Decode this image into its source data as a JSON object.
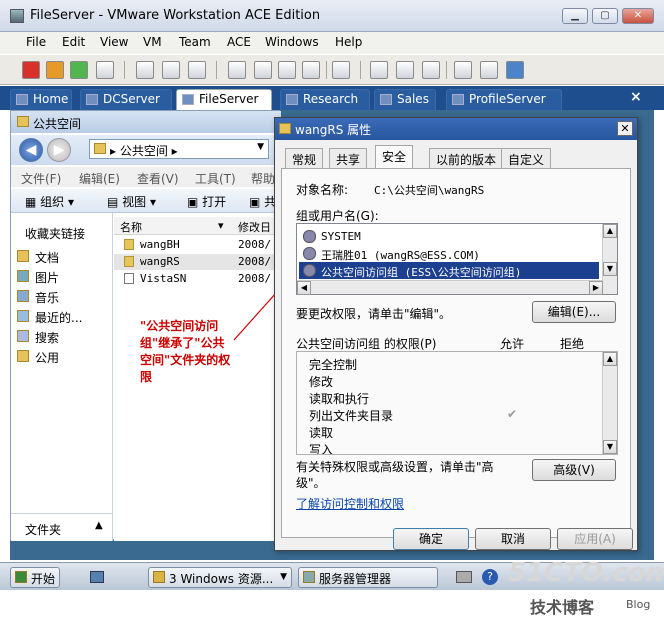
{
  "window": {
    "title": "FileServer - VMware Workstation ACE Edition"
  },
  "menubar": [
    "File",
    "Edit",
    "View",
    "VM",
    "Team",
    "ACE",
    "Windows",
    "Help"
  ],
  "tabs": [
    {
      "label": "Home",
      "active": false
    },
    {
      "label": "DCServer",
      "active": false
    },
    {
      "label": "FileServer",
      "active": true
    },
    {
      "label": "Research",
      "active": false
    },
    {
      "label": "Sales",
      "active": false
    },
    {
      "label": "ProfileServer",
      "active": false
    }
  ],
  "tab_close": "×",
  "explorer": {
    "title": "公共空间",
    "address": "▸ 公共空间 ▸",
    "menu": [
      "文件(F)",
      "编辑(E)",
      "查看(V)",
      "工具(T)",
      "帮助"
    ],
    "commands": {
      "organize": "组织",
      "views": "视图",
      "open": "打开",
      "share": "共"
    },
    "nav_header": "收藏夹链接",
    "nav_items": [
      "文档",
      "图片",
      "音乐",
      "最近的...",
      "搜索",
      "公用"
    ],
    "nav_footer": "文件夹",
    "columns": {
      "name": "名称",
      "date": "修改日"
    },
    "files": [
      {
        "name": "wangBH",
        "date": "2008/",
        "selected": false,
        "type": "folder"
      },
      {
        "name": "wangRS",
        "date": "2008/",
        "selected": true,
        "type": "folder"
      },
      {
        "name": "VistaSN",
        "date": "2008/",
        "selected": false,
        "type": "doc"
      }
    ]
  },
  "annotation": {
    "text": "\"公共空间访问组\"继承了\"公共空间\"文件夹的权限",
    "line_color": "#cc0000"
  },
  "dialog": {
    "title": "wangRS 属性",
    "close": "✕",
    "tabs": [
      {
        "label": "常规",
        "active": false
      },
      {
        "label": "共享",
        "active": false
      },
      {
        "label": "安全",
        "active": true
      },
      {
        "label": "以前的版本",
        "active": false
      },
      {
        "label": "自定义",
        "active": false
      }
    ],
    "object_label": "对象名称:",
    "object_value": "C:\\公共空间\\wangRS",
    "group_label": "组或用户名(G):",
    "groups": [
      {
        "name": "SYSTEM",
        "selected": false
      },
      {
        "name": "王瑞胜01 (wangRS@ESS.COM)",
        "selected": false
      },
      {
        "name": "公共空间访问组 (ESS\\公共空间访问组)",
        "selected": true
      }
    ],
    "edit_hint": "要更改权限，请单击\"编辑\"。",
    "edit_button": "编辑(E)...",
    "perm_header": "公共空间访问组 的权限(P)",
    "allow_header": "允许",
    "deny_header": "拒绝",
    "permissions": [
      "完全控制",
      "修改",
      "读取和执行",
      "列出文件夹目录",
      "读取",
      "写入"
    ],
    "checkmark": "✔",
    "advanced_hint": "有关特殊权限或高级设置，请单击\"高级\"。",
    "advanced_button": "高级(V)",
    "link": "了解访问控制和权限",
    "ok": "确定",
    "cancel": "取消",
    "apply": "应用(A)"
  },
  "taskbar": {
    "start": "开始",
    "items": [
      "3 Windows 资源...",
      "服务器管理器"
    ]
  },
  "watermark": {
    "site": "51CTO.com",
    "sub": "技术博客",
    "blog": "Blog"
  }
}
